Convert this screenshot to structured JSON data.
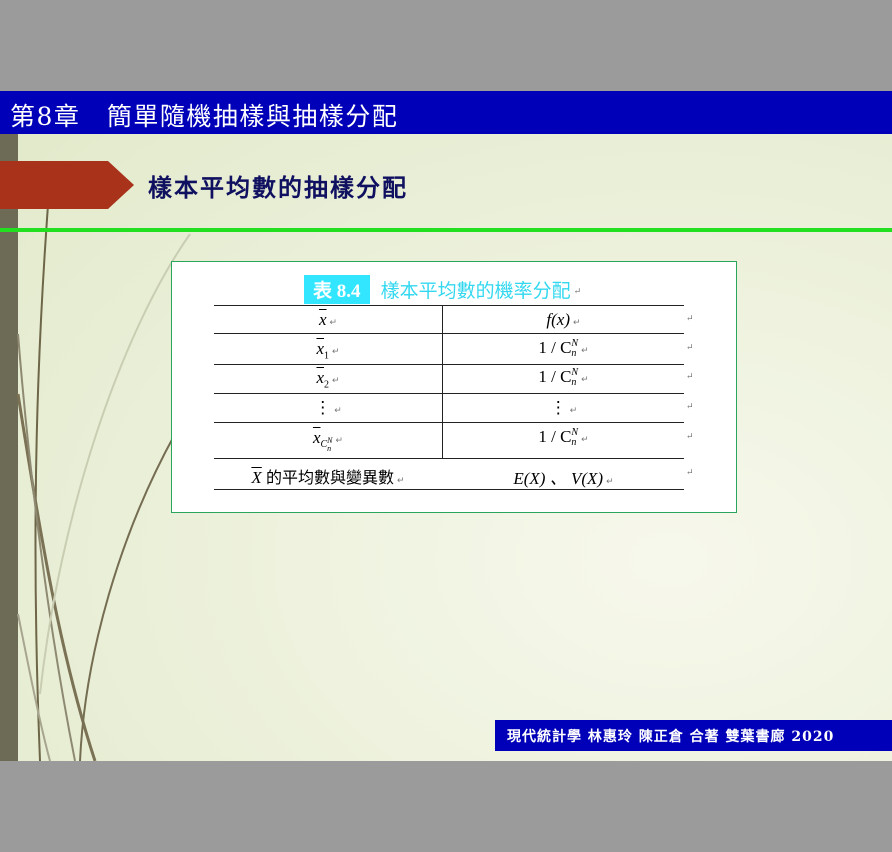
{
  "header": {
    "chapter_title": "第8章　簡單隨機抽樣與抽樣分配"
  },
  "section": {
    "title": "樣本平均數的抽樣分配"
  },
  "table": {
    "caption_tag": "表 8.4",
    "caption_title": "樣本平均數的機率分配",
    "col1_header": "x",
    "col2_header": "f(x)",
    "rows": [
      {
        "col1_base": "x",
        "col1_sub": "1",
        "col2_prefix": "1 / C",
        "col2_sup": "N",
        "col2_sub": "n"
      },
      {
        "col1_base": "x",
        "col1_sub": "2",
        "col2_prefix": "1 / C",
        "col2_sup": "N",
        "col2_sub": "n"
      },
      {
        "col1_base": "⋮",
        "col2_prefix": "⋮"
      },
      {
        "col1_base": "x",
        "col1_sub_base": "C",
        "col1_sub_sup": "N",
        "col1_sub_sub": "n",
        "col2_prefix": "1 / C",
        "col2_sup": "N",
        "col2_sub": "n"
      }
    ],
    "footer_left_symbol": "X",
    "footer_left_text": "的平均數與變異數",
    "footer_right": "E(X) 、 V(X)",
    "return_mark": "↵"
  },
  "footer": {
    "credit": "現代統計學  林惠玲 陳正倉 合著  雙葉書廊  2020"
  },
  "colors": {
    "chapter_bar": "#0000b8",
    "arrow_tab": "#a8331a",
    "divider": "#22e020",
    "caption": "#33e6ff",
    "footer_bar": "#0000b8"
  }
}
